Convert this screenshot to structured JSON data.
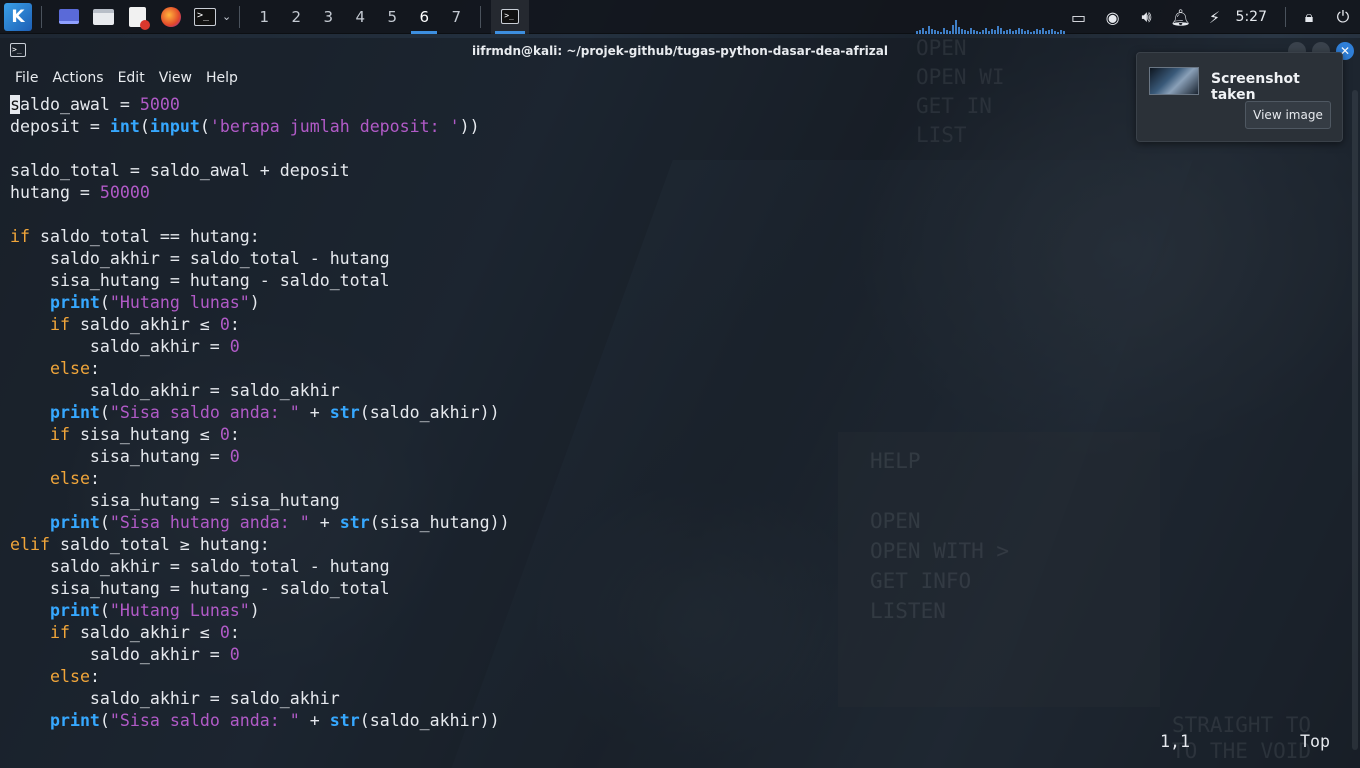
{
  "panel": {
    "workspaces": [
      "1",
      "2",
      "3",
      "4",
      "5",
      "6",
      "7"
    ],
    "active_workspace": "6",
    "clock": "5:27",
    "icons": [
      "kali-menu-icon",
      "desktop-icon",
      "file-manager-icon",
      "text-editor-icon",
      "firefox-icon",
      "terminal-icon",
      "chevron-down-icon",
      "screen-icon",
      "discord-icon",
      "volume-icon",
      "bell-icon",
      "power-icon",
      "lock-icon",
      "logout-icon"
    ]
  },
  "terminal": {
    "title": "iifrmdn@kali: ~/projek-github/tugas-python-dasar-dea-afrizal",
    "menu": [
      "File",
      "Actions",
      "Edit",
      "View",
      "Help"
    ],
    "status_position": "1,1",
    "status_scroll": "Top"
  },
  "code_lines": [
    [
      {
        "t": "s",
        "c": "cursor"
      },
      {
        "t": "aldo_awal = ",
        "c": ""
      },
      {
        "t": "5000",
        "c": "num"
      }
    ],
    [
      {
        "t": "deposit = ",
        "c": ""
      },
      {
        "t": "int",
        "c": "fn"
      },
      {
        "t": "(",
        "c": ""
      },
      {
        "t": "input",
        "c": "fn"
      },
      {
        "t": "(",
        "c": ""
      },
      {
        "t": "'berapa jumlah deposit: '",
        "c": "str"
      },
      {
        "t": "))",
        "c": ""
      }
    ],
    [],
    [
      {
        "t": "saldo_total = saldo_awal + deposit",
        "c": ""
      }
    ],
    [
      {
        "t": "hutang = ",
        "c": ""
      },
      {
        "t": "50000",
        "c": "num"
      }
    ],
    [],
    [
      {
        "t": "if",
        "c": "kw"
      },
      {
        "t": " saldo_total == hutang:",
        "c": ""
      }
    ],
    [
      {
        "t": "    saldo_akhir = saldo_total - hutang",
        "c": ""
      }
    ],
    [
      {
        "t": "    sisa_hutang = hutang - saldo_total",
        "c": ""
      }
    ],
    [
      {
        "t": "    ",
        "c": ""
      },
      {
        "t": "print",
        "c": "fn"
      },
      {
        "t": "(",
        "c": ""
      },
      {
        "t": "\"Hutang lunas\"",
        "c": "str"
      },
      {
        "t": ")",
        "c": ""
      }
    ],
    [
      {
        "t": "    ",
        "c": ""
      },
      {
        "t": "if",
        "c": "kw"
      },
      {
        "t": " saldo_akhir ≤ ",
        "c": ""
      },
      {
        "t": "0",
        "c": "num"
      },
      {
        "t": ":",
        "c": ""
      }
    ],
    [
      {
        "t": "        saldo_akhir = ",
        "c": ""
      },
      {
        "t": "0",
        "c": "num"
      }
    ],
    [
      {
        "t": "    ",
        "c": ""
      },
      {
        "t": "else",
        "c": "kw"
      },
      {
        "t": ":",
        "c": ""
      }
    ],
    [
      {
        "t": "        saldo_akhir = saldo_akhir",
        "c": ""
      }
    ],
    [
      {
        "t": "    ",
        "c": ""
      },
      {
        "t": "print",
        "c": "fn"
      },
      {
        "t": "(",
        "c": ""
      },
      {
        "t": "\"Sisa saldo anda: \"",
        "c": "str"
      },
      {
        "t": " + ",
        "c": ""
      },
      {
        "t": "str",
        "c": "fn"
      },
      {
        "t": "(saldo_akhir))",
        "c": ""
      }
    ],
    [
      {
        "t": "    ",
        "c": ""
      },
      {
        "t": "if",
        "c": "kw"
      },
      {
        "t": " sisa_hutang ≤ ",
        "c": ""
      },
      {
        "t": "0",
        "c": "num"
      },
      {
        "t": ":",
        "c": ""
      }
    ],
    [
      {
        "t": "        sisa_hutang = ",
        "c": ""
      },
      {
        "t": "0",
        "c": "num"
      }
    ],
    [
      {
        "t": "    ",
        "c": ""
      },
      {
        "t": "else",
        "c": "kw"
      },
      {
        "t": ":",
        "c": ""
      }
    ],
    [
      {
        "t": "        sisa_hutang = sisa_hutang",
        "c": ""
      }
    ],
    [
      {
        "t": "    ",
        "c": ""
      },
      {
        "t": "print",
        "c": "fn"
      },
      {
        "t": "(",
        "c": ""
      },
      {
        "t": "\"Sisa hutang anda: \"",
        "c": "str"
      },
      {
        "t": " + ",
        "c": ""
      },
      {
        "t": "str",
        "c": "fn"
      },
      {
        "t": "(sisa_hutang))",
        "c": ""
      }
    ],
    [
      {
        "t": "elif",
        "c": "kw"
      },
      {
        "t": " saldo_total ≥ hutang:",
        "c": ""
      }
    ],
    [
      {
        "t": "    saldo_akhir = saldo_total - hutang",
        "c": ""
      }
    ],
    [
      {
        "t": "    sisa_hutang = hutang - saldo_total",
        "c": ""
      }
    ],
    [
      {
        "t": "    ",
        "c": ""
      },
      {
        "t": "print",
        "c": "fn"
      },
      {
        "t": "(",
        "c": ""
      },
      {
        "t": "\"Hutang Lunas\"",
        "c": "str"
      },
      {
        "t": ")",
        "c": ""
      }
    ],
    [
      {
        "t": "    ",
        "c": ""
      },
      {
        "t": "if",
        "c": "kw"
      },
      {
        "t": " saldo_akhir ≤ ",
        "c": ""
      },
      {
        "t": "0",
        "c": "num"
      },
      {
        "t": ":",
        "c": ""
      }
    ],
    [
      {
        "t": "        saldo_akhir = ",
        "c": ""
      },
      {
        "t": "0",
        "c": "num"
      }
    ],
    [
      {
        "t": "    ",
        "c": ""
      },
      {
        "t": "else",
        "c": "kw"
      },
      {
        "t": ":",
        "c": ""
      }
    ],
    [
      {
        "t": "        saldo_akhir = saldo_akhir",
        "c": ""
      }
    ],
    [
      {
        "t": "    ",
        "c": ""
      },
      {
        "t": "print",
        "c": "fn"
      },
      {
        "t": "(",
        "c": ""
      },
      {
        "t": "\"Sisa saldo anda: \"",
        "c": "str"
      },
      {
        "t": " + ",
        "c": ""
      },
      {
        "t": "str",
        "c": "fn"
      },
      {
        "t": "(saldo_akhir))",
        "c": ""
      }
    ]
  ],
  "notification": {
    "title": "Screenshot taken",
    "button": "View image"
  },
  "wallpaper": {
    "top_menu": [
      "OPEN",
      "OPEN WI",
      "GET IN",
      "LIST"
    ],
    "popup_menu": [
      "HELP",
      "",
      "OPEN",
      "OPEN WITH  >",
      "GET INFO",
      "LISTEN"
    ],
    "bottom_text": [
      "STRAIGHT TO",
      "TO THE VOID"
    ]
  },
  "colors": {
    "keyword": "#f0a53a",
    "builtin": "#36a8ff",
    "string": "#b15ac7",
    "accent": "#3d8fe0"
  }
}
